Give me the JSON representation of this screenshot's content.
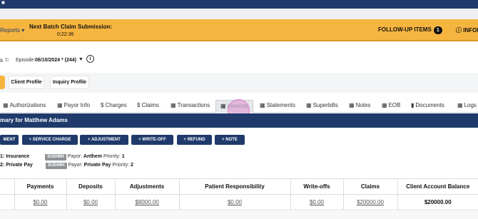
{
  "topbar": {
    "user_icon": "user-icon"
  },
  "header": {
    "reports_label": "Reports",
    "batch_title": "Next Batch Claim Submission:",
    "batch_time": "0:22:36",
    "followup_label": "FOLLOW-UP ITEMS",
    "followup_count": "1",
    "info_label": "INFORM"
  },
  "episode": {
    "label": "Episode:",
    "value": "06/10/2024 * (244)"
  },
  "profiles": {
    "client_profile": "Client Profile",
    "inquiry_profile": "Inquiry Profile"
  },
  "tabs": [
    {
      "label": "Authorizations",
      "icon": "table-icon"
    },
    {
      "label": "Payor Info",
      "icon": "table-icon"
    },
    {
      "label": "Charges",
      "icon": "dollar-icon"
    },
    {
      "label": "Claims",
      "icon": "dollar-icon"
    },
    {
      "label": "Transactions",
      "icon": "table-icon"
    },
    {
      "label": "Invoices",
      "icon": "table-icon"
    },
    {
      "label": "Statements",
      "icon": "table-icon"
    },
    {
      "label": "Superbills",
      "icon": "table-icon"
    },
    {
      "label": "Notes",
      "icon": "table-icon"
    },
    {
      "label": "EOB",
      "icon": "table-icon"
    },
    {
      "label": "Documents",
      "icon": "document-icon"
    },
    {
      "label": "Logs",
      "icon": "table-icon"
    }
  ],
  "summary": {
    "title": "mary for Matthew Adams"
  },
  "actions": [
    "MENT",
    "+ SERVICE CHARGE",
    "+ ADJUSTMENT",
    "+ WRITE-OFF",
    "+ REFUND",
    "+ NOTE"
  ],
  "payers": [
    {
      "prefix": "1:",
      "type": "Insurance",
      "tag": "SUD/MH",
      "payor_label": "Payor:",
      "payor": "Anthem",
      "priority_label": "Priority:",
      "priority": "1"
    },
    {
      "prefix": "2:",
      "type": "Private Pay",
      "tag": "SUD/MH",
      "payor_label": "Payor:",
      "payor": "Private Pay",
      "priority_label": "Priority:",
      "priority": "2"
    }
  ],
  "table": {
    "headers": [
      "Payments",
      "Deposits",
      "Adjustments",
      "Patient Responsibility",
      "Write-offs",
      "Claims",
      "Client Account Balance"
    ],
    "row": [
      "$0.00",
      "$0.00",
      "$8000.00",
      "$0.00",
      "$0.00",
      "$20000.00",
      "$20000.00"
    ]
  }
}
